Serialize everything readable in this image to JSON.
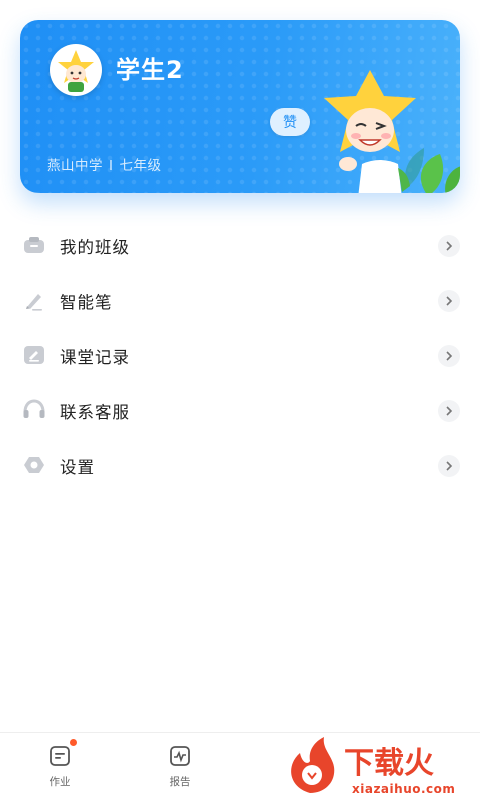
{
  "profile": {
    "name": "学生2",
    "school": "燕山中学",
    "separator": "I",
    "grade": "七年级",
    "like_label": "赞"
  },
  "menu": {
    "items": [
      {
        "label": "我的班级",
        "icon": "class-icon"
      },
      {
        "label": "智能笔",
        "icon": "pen-icon"
      },
      {
        "label": "课堂记录",
        "icon": "record-icon"
      },
      {
        "label": "联系客服",
        "icon": "headset-icon"
      },
      {
        "label": "设置",
        "icon": "settings-icon"
      }
    ]
  },
  "tabbar": {
    "tabs": [
      {
        "label": "作业",
        "icon": "homework-icon",
        "has_dot": true
      },
      {
        "label": "报告",
        "icon": "report-icon",
        "has_dot": false
      }
    ]
  },
  "watermark": {
    "brand": "下载火",
    "url": "xiazaihuo.com"
  },
  "colors": {
    "accent": "#1f8ff5",
    "badge_dot": "#ff5a2a",
    "watermark": "#e8452b"
  }
}
